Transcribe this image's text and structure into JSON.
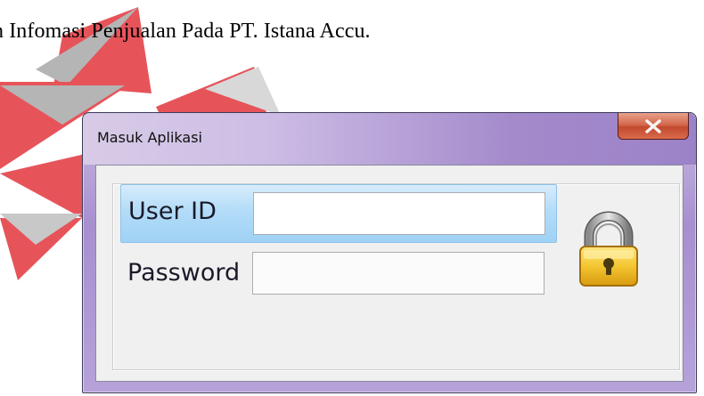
{
  "caption": "n Infomasi Penjualan Pada PT. Istana Accu.",
  "window": {
    "title": "Masuk Aplikasi",
    "close_icon": "close-icon"
  },
  "form": {
    "user_id_label": "User ID",
    "user_id_value": "",
    "password_label": "Password",
    "password_value": ""
  },
  "icons": {
    "lock": "padlock-icon"
  },
  "colors": {
    "logo_red": "#e6545a",
    "logo_gray": "#b5b5b5",
    "title_bar": "#a88fd0",
    "close_button": "#c94a2f",
    "selection": "#a9d6f7"
  }
}
